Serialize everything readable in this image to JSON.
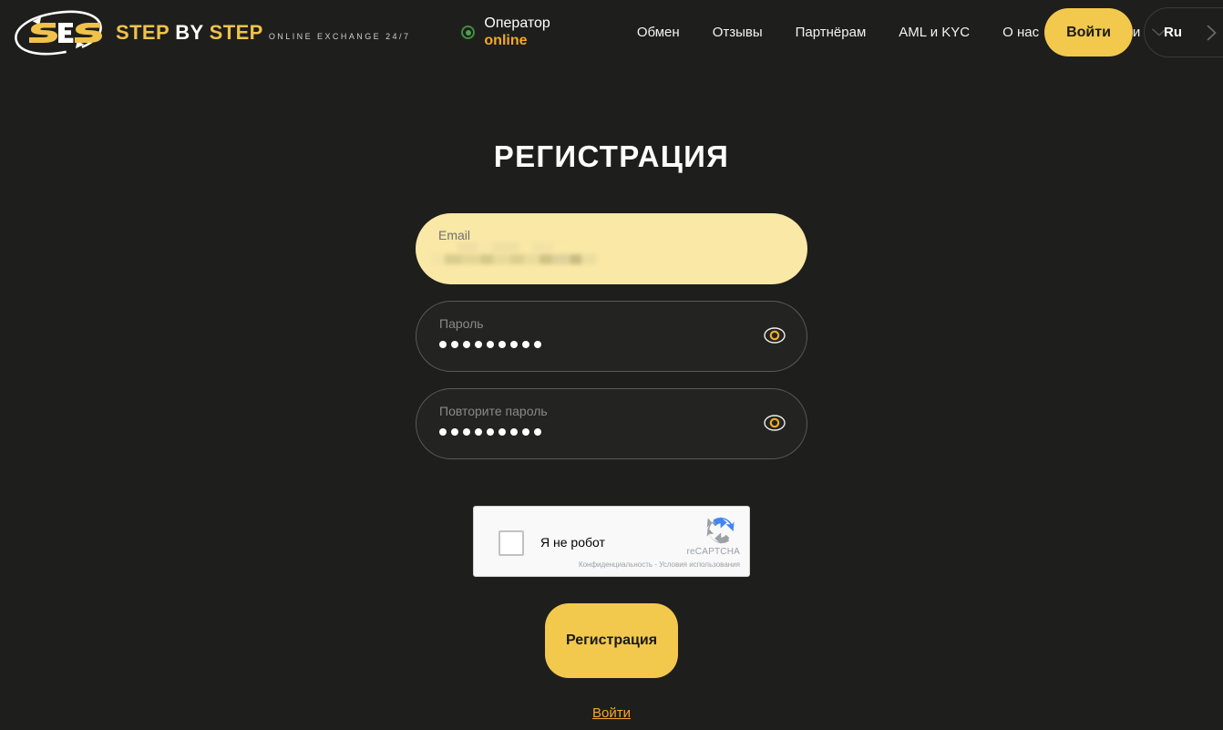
{
  "brand": {
    "logo_icon": "s3s-logo-icon",
    "title_part1": "STEP",
    "title_part2": "BY",
    "title_part3": "STEP",
    "tagline": "ONLINE EXCHANGE 24/7"
  },
  "operator": {
    "status_icon": "green-status-dot-icon",
    "label": "Оператор",
    "state": "online",
    "state_color": "#f0a92b",
    "dot_color": "#4aa24a"
  },
  "nav": {
    "items": [
      {
        "label": "Обмен",
        "has_dropdown": false
      },
      {
        "label": "Отзывы",
        "has_dropdown": false
      },
      {
        "label": "Партнёрам",
        "has_dropdown": false
      },
      {
        "label": "AML и KYC",
        "has_dropdown": false
      },
      {
        "label": "О нас",
        "has_dropdown": true,
        "dropdown_icon": "chevron-down-icon"
      },
      {
        "label": "Услуги",
        "has_dropdown": true,
        "dropdown_icon": "chevron-down-icon"
      }
    ]
  },
  "header_actions": {
    "login_label": "Войти",
    "language_code": "Ru",
    "language_icon": "chevron-right-icon",
    "accent_color": "#f2c94c"
  },
  "page": {
    "title": "РЕГИСТРАЦИЯ"
  },
  "form": {
    "email": {
      "label": "Email",
      "placeholder": "Email",
      "value": "",
      "redacted": true,
      "autofilled": true,
      "background_color": "#f9e8a6"
    },
    "password": {
      "label": "Пароль",
      "placeholder": "Пароль",
      "value": "•••••••••",
      "masked_length": 9,
      "reveal_icon": "eye-icon"
    },
    "password_repeat": {
      "label": "Повторите пароль",
      "placeholder": "Повторите пароль",
      "value": "•••••••••",
      "masked_length": 9,
      "reveal_icon": "eye-icon"
    },
    "recaptcha": {
      "checkbox_label": "Я не робот",
      "checked": false,
      "brand": "reCAPTCHA",
      "terms": "Конфиденциальность - Условия использования",
      "logo_icon": "recaptcha-logo-icon"
    },
    "submit_label": "Регистрация",
    "bottom_link_label": "Войти"
  }
}
